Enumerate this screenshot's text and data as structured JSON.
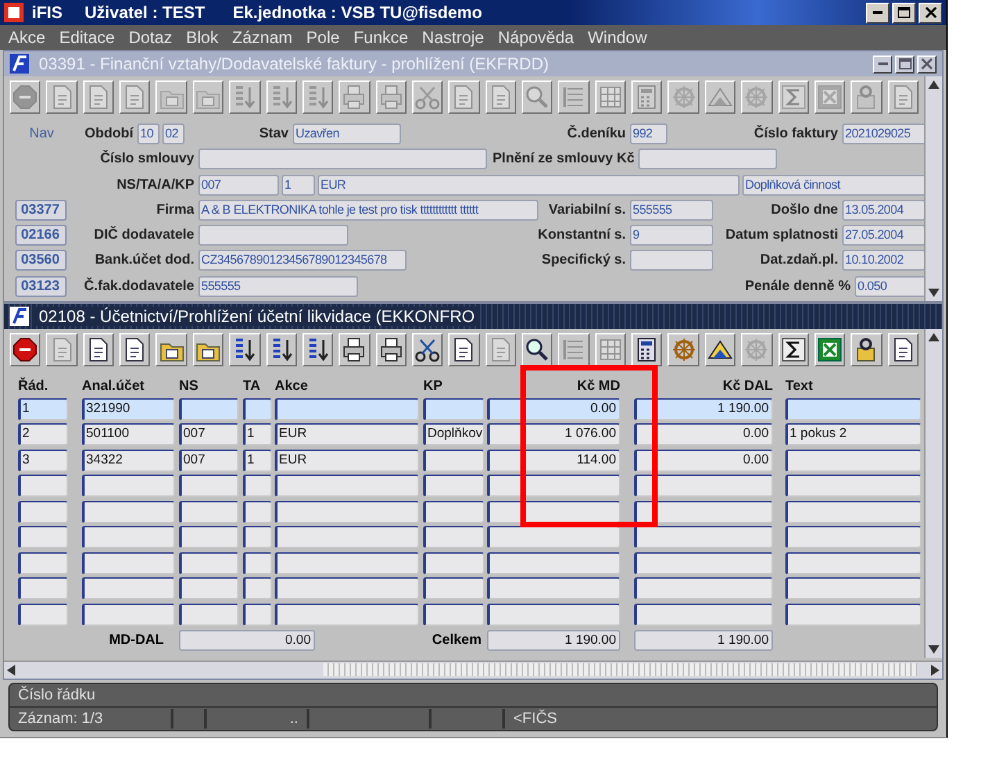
{
  "window": {
    "app": "iFIS",
    "user": "Uživatel : TEST",
    "unit": "Ek.jednotka : VSB TU@fisdemo"
  },
  "menu": [
    "Akce",
    "Editace",
    "Dotaz",
    "Blok",
    "Záznam",
    "Pole",
    "Funkce",
    "Nastroje",
    "Nápověda",
    "Window"
  ],
  "invoice_window": {
    "title": "03391 - Finanční vztahy/Dodavatelské faktury - prohlížení (EKFRDD)",
    "toolbar": [
      {
        "kind": "exit",
        "disabled": true
      },
      {
        "kind": "doc",
        "disabled": true
      },
      {
        "kind": "doc",
        "disabled": true
      },
      {
        "kind": "doc",
        "disabled": true
      },
      {
        "kind": "folder",
        "disabled": true
      },
      {
        "kind": "folder",
        "disabled": true
      },
      {
        "kind": "sort",
        "disabled": true
      },
      {
        "kind": "sort",
        "disabled": true
      },
      {
        "kind": "sort",
        "disabled": true
      },
      {
        "kind": "print",
        "disabled": true
      },
      {
        "kind": "print",
        "disabled": true
      },
      {
        "kind": "scissors",
        "disabled": true
      },
      {
        "kind": "doc",
        "disabled": true
      },
      {
        "kind": "doc",
        "disabled": true
      },
      {
        "kind": "search",
        "disabled": true
      },
      {
        "kind": "list",
        "disabled": true
      },
      {
        "kind": "grid",
        "disabled": true
      },
      {
        "kind": "calc",
        "disabled": true
      },
      {
        "kind": "wheel",
        "disabled": true
      },
      {
        "kind": "triangle",
        "disabled": true
      },
      {
        "kind": "wheel",
        "disabled": true
      },
      {
        "kind": "sigma",
        "disabled": true
      },
      {
        "kind": "sheet",
        "disabled": true
      },
      {
        "kind": "help",
        "disabled": true
      },
      {
        "kind": "doc",
        "disabled": true
      }
    ],
    "nav": {
      "label": "Nav",
      "selected": false
    },
    "nav_buttons": [
      "03377",
      "02166",
      "03560",
      "03123"
    ],
    "fields": [
      {
        "label": "Období",
        "values": [
          "10",
          "02"
        ]
      },
      {
        "label": "Stav",
        "values": [
          "Uzavřen"
        ]
      },
      {
        "label": "Č.deníku",
        "values": [
          "992"
        ]
      },
      {
        "label": "Číslo faktury",
        "values": [
          "2021029025"
        ]
      },
      {
        "label": "Číslo smlouvy"
      },
      {
        "label": "Plnění ze smlouvy Kč"
      },
      {
        "label": "NS/TA/A/KP",
        "values": [
          "007",
          "1",
          "EUR",
          "Doplňková činnost"
        ]
      },
      {
        "label": "Firma",
        "values": [
          "A & B ELEKTRONIKA tohle je test pro tisk tttttttttttt tttttt"
        ]
      },
      {
        "label": "Variabilní s.",
        "values": [
          "555555"
        ]
      },
      {
        "label": "Došlo dne",
        "values": [
          "13.05.2004"
        ]
      },
      {
        "label": "DIČ dodavatele"
      },
      {
        "label": "Konstantní s.",
        "values": [
          "9"
        ]
      },
      {
        "label": "Datum splatnosti",
        "values": [
          "27.05.2004"
        ]
      },
      {
        "label": "Bank.účet dod.",
        "values": [
          "CZ34567890123456789012345678"
        ]
      },
      {
        "label": "Specifický s."
      },
      {
        "label": "Dat.zdaň.pl.",
        "values": [
          "10.10.2002"
        ]
      },
      {
        "label": "Č.fak.dodavatele",
        "values": [
          "555555"
        ]
      },
      {
        "label": "Penále denně %",
        "values": [
          "0.050"
        ]
      }
    ]
  },
  "posting_window": {
    "title": "02108 - Účetnictví/Prohlížení účetní likvidace (EKKONFRO",
    "toolbar": [
      {
        "kind": "exit",
        "disabled": false
      },
      {
        "kind": "doc",
        "disabled": true
      },
      {
        "kind": "doc",
        "disabled": false
      },
      {
        "kind": "doc",
        "disabled": false
      },
      {
        "kind": "folder",
        "disabled": false
      },
      {
        "kind": "folder",
        "disabled": false
      },
      {
        "kind": "sort",
        "disabled": false
      },
      {
        "kind": "sort",
        "disabled": false
      },
      {
        "kind": "sort",
        "disabled": false
      },
      {
        "kind": "print",
        "disabled": false
      },
      {
        "kind": "print",
        "disabled": false
      },
      {
        "kind": "scissors",
        "disabled": false
      },
      {
        "kind": "doc",
        "disabled": false
      },
      {
        "kind": "doc",
        "disabled": true
      },
      {
        "kind": "search",
        "disabled": false
      },
      {
        "kind": "list",
        "disabled": true
      },
      {
        "kind": "grid",
        "disabled": true
      },
      {
        "kind": "calc",
        "disabled": false
      },
      {
        "kind": "wheel",
        "disabled": false
      },
      {
        "kind": "triangle",
        "disabled": false
      },
      {
        "kind": "wheel",
        "disabled": true
      },
      {
        "kind": "sigma",
        "disabled": false
      },
      {
        "kind": "sheet",
        "disabled": false
      },
      {
        "kind": "help",
        "disabled": false
      },
      {
        "kind": "doc",
        "disabled": false
      }
    ],
    "table": {
      "columns": [
        {
          "label": "Řád.",
          "kind": "text"
        },
        {
          "label": "Anal.účet",
          "kind": "text"
        },
        {
          "label": "NS",
          "kind": "text"
        },
        {
          "label": "TA",
          "kind": "text"
        },
        {
          "label": "Akce",
          "kind": "text"
        },
        {
          "label": "KP",
          "kind": "text"
        },
        {
          "label": "Kč MD",
          "kind": "number",
          "highlighted": true
        },
        {
          "label": "Kč DAL",
          "kind": "number",
          "highlighted": false
        },
        {
          "label": "Text",
          "kind": "text"
        }
      ],
      "rows": [
        {
          "selected": true,
          "cells": [
            "1",
            "321990",
            null,
            null,
            null,
            null,
            "0.00",
            "1 190.00",
            null
          ]
        },
        {
          "selected": false,
          "cells": [
            "2",
            "501100",
            "007",
            "1",
            "EUR",
            "Doplňkov",
            "1 076.00",
            "0.00",
            "1 pokus 2"
          ]
        },
        {
          "selected": false,
          "cells": [
            "3",
            "34322",
            "007",
            "1",
            "EUR",
            null,
            "114.00",
            "0.00",
            null
          ]
        }
      ]
    },
    "totals": [
      {
        "label": "MD-DAL",
        "values": [
          "0.00"
        ]
      },
      {
        "label": "Celkem",
        "values": [
          "1 190.00",
          "1 190.00"
        ]
      }
    ]
  },
  "status_bar": {
    "line": "Číslo řádku",
    "segments": [
      "Záznam: 1/3",
      "..",
      "<FIČS"
    ]
  }
}
